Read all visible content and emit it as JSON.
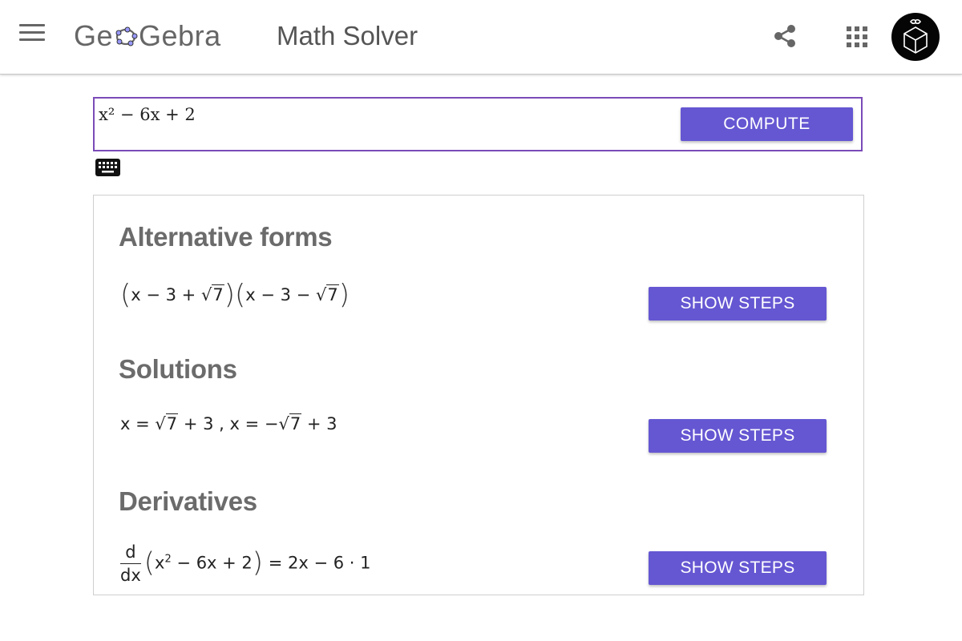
{
  "header": {
    "logo_text_a": "Ge",
    "logo_text_b": "Gebra",
    "app_title": "Math Solver"
  },
  "input": {
    "expression": "x² − 6x + 2",
    "compute_label": "COMPUTE"
  },
  "sections": {
    "alternative_forms": {
      "title": "Alternative forms",
      "steps_label": "SHOW STEPS"
    },
    "solutions": {
      "title": "Solutions",
      "steps_label": "SHOW STEPS"
    },
    "derivatives": {
      "title": "Derivatives",
      "steps_label": "SHOW STEPS"
    }
  },
  "math": {
    "alt_f1_a": "x − 3 + ",
    "alt_f1_rad": "7",
    "alt_f2_a": "x − 3 − ",
    "alt_f2_rad": "7",
    "sol_1_a": "x = ",
    "sol_1_rad": "7",
    "sol_1_b": " + 3 ,  x = −",
    "sol_2_rad": "7",
    "sol_2_b": " + 3",
    "deriv_num": "d",
    "deriv_den": "dx",
    "deriv_inner_a": "x",
    "deriv_inner_exp": "2",
    "deriv_inner_b": " − 6x + 2",
    "deriv_result": " = 2x − 6 · 1"
  },
  "colors": {
    "accent": "#6557d2",
    "input_border": "#7b4bb8",
    "heading": "#6b6b6b"
  },
  "icons": [
    "menu-icon",
    "share-icon",
    "apps-grid-icon",
    "keyboard-icon",
    "user-avatar"
  ]
}
